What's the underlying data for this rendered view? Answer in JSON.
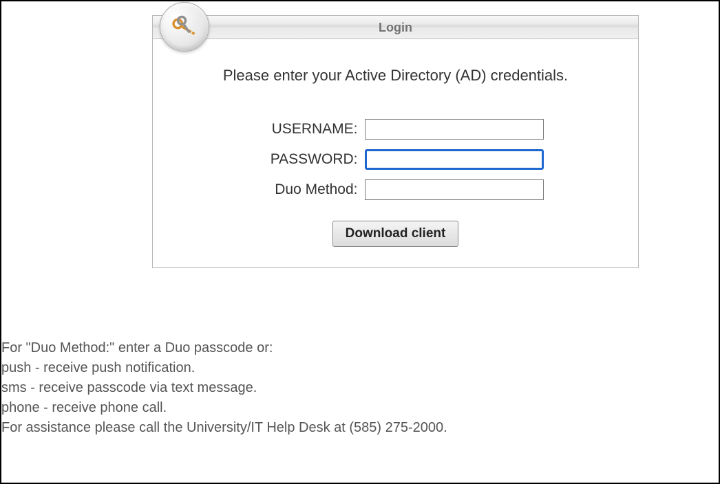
{
  "login": {
    "header_title": "Login",
    "instruction": "Please enter your Active Directory (AD) credentials.",
    "fields": {
      "username": {
        "label": "USERNAME:",
        "value": ""
      },
      "password": {
        "label": "PASSWORD:",
        "value": ""
      },
      "duo": {
        "label": "Duo Method:",
        "value": ""
      }
    },
    "button_label": "Download client"
  },
  "help": {
    "line1": "For \"Duo Method:\" enter a Duo passcode or:",
    "line2": "push - receive push notification.",
    "line3": "sms - receive passcode via text message.",
    "line4": "phone - receive phone call.",
    "assist": "For assistance please call the University/IT Help Desk at (585) 275-2000."
  }
}
